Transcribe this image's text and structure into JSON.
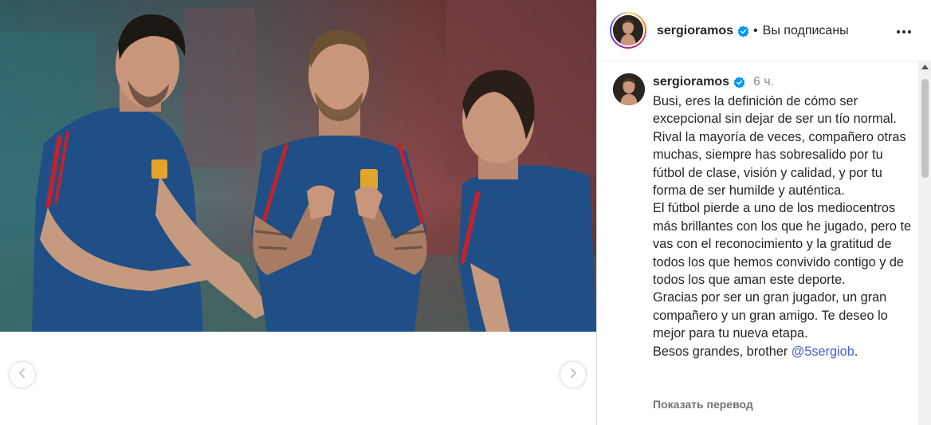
{
  "post": {
    "username": "sergioramos",
    "follow_status": "Вы подписаны",
    "separator": "•",
    "time_ago": "6 ч."
  },
  "caption": {
    "paragraph1": "Busi, eres la definición de cómo ser excepcional sin dejar de ser un tío normal. Rival la mayoría de veces, compañero otras muchas, siempre has sobresalido por tu fútbol de clase, visión y calidad, y por tu forma de ser humilde y auténtica.",
    "paragraph2": "El fútbol pierde a uno de los mediocentros más brillantes con los que he jugado, pero te vas con el reconocimiento y la gratitud de todos los que hemos convivido contigo y de todos los que aman este deporte.",
    "paragraph3": "Gracias por ser un gran jugador, un gran compañero y un gran amigo. Te deseo lo mejor para tu nueva etapa.",
    "closing": "Besos grandes, brother ",
    "mention": "@5sergiob",
    "closing_end": "."
  },
  "translate_label": "Показать перевод",
  "icons": {
    "prev": "chevron-left-icon",
    "next": "chevron-right-icon",
    "more": "more-horizontal-icon",
    "verified": "verified-badge-icon"
  },
  "colors": {
    "verified_blue": "#0095f6",
    "mention_blue": "#4a5bd6",
    "jersey_blue": "#1f4f86",
    "jersey_red": "#c0232c"
  }
}
